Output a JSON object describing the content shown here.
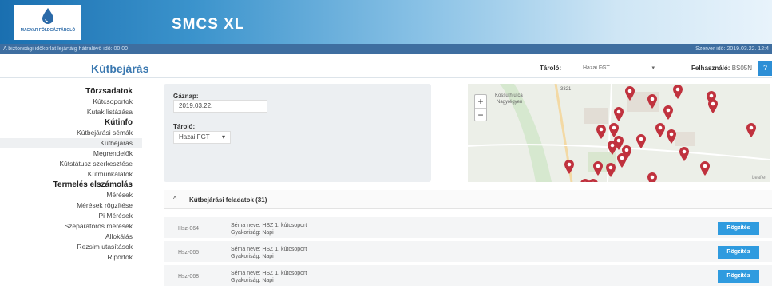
{
  "header": {
    "logo_text": "MAGYAR FÖLDGÁZTÁROLÓ",
    "app_title": "SMCS XL"
  },
  "statusbar": {
    "left": "A biztonsági időkorlát lejártáig hátralévő idő: 00:00",
    "right": "Szerver idő: 2019.03.22. 12:4"
  },
  "titlebar": {
    "page_title": "Kútbejárás",
    "tarolo_label": "Tároló:",
    "tarolo_value": "Hazai FGT",
    "caret": "▾",
    "user_label": "Felhasználó:",
    "user_value": "BS05N",
    "help": "?"
  },
  "sidebar": {
    "items": [
      {
        "label": "Törzsadatok",
        "section": true
      },
      {
        "label": "Kútcsoportok"
      },
      {
        "label": "Kutak listázása"
      },
      {
        "label": "Kútinfo",
        "section": true
      },
      {
        "label": "Kútbejárási sémák"
      },
      {
        "label": "Kútbejárás",
        "active": true
      },
      {
        "label": "Megrendelők"
      },
      {
        "label": "Kútstátusz szerkesztése"
      },
      {
        "label": "Kútmunkálatok"
      },
      {
        "label": "Termelés elszámolás",
        "section": true
      },
      {
        "label": "Mérések"
      },
      {
        "label": "Mérések rögzítése"
      },
      {
        "label": "Pi Mérések"
      },
      {
        "label": "Szeparátoros mérések"
      },
      {
        "label": "Allokálás"
      },
      {
        "label": "Rezsim utasítások"
      },
      {
        "label": "Riportok"
      }
    ]
  },
  "filter": {
    "gaznap_label": "Gáznap:",
    "gaznap_value": "2019.03.22.",
    "tarolo_label": "Tároló:",
    "tarolo_value": "Hazai FGT",
    "caret": "▾"
  },
  "map": {
    "zoom_in": "+",
    "zoom_out": "−",
    "label_1": "Kossuth utca",
    "label_2": "Nagyrégyen",
    "label_3": "3321",
    "attribution": "Leaflet"
  },
  "tasks_section": {
    "chevron": "^",
    "title": "Kútbejárási feladatok (31)"
  },
  "tasks": [
    {
      "code": "Hsz-064",
      "sema_label": "Séma neve:",
      "sema": "HSZ 1. kútcsoport",
      "freq_label": "Gyakoriság:",
      "freq": "Napi",
      "button": "Rögzítés"
    },
    {
      "code": "Hsz-065",
      "sema_label": "Séma neve:",
      "sema": "HSZ 1. kútcsoport",
      "freq_label": "Gyakoriság:",
      "freq": "Napi",
      "button": "Rögzítés"
    },
    {
      "code": "Hsz-068",
      "sema_label": "Séma neve:",
      "sema": "HSZ 1. kútcsoport",
      "freq_label": "Gyakoriság:",
      "freq": "Napi",
      "button": "Rögzítés"
    }
  ],
  "colors": {
    "accent": "#2f9bdf",
    "pin": "#c0323e",
    "header_dark": "#1a6fb0"
  },
  "icons": [
    "drop-logo-icon",
    "map-pin-icon",
    "chevron-up-icon",
    "caret-down-icon"
  ]
}
